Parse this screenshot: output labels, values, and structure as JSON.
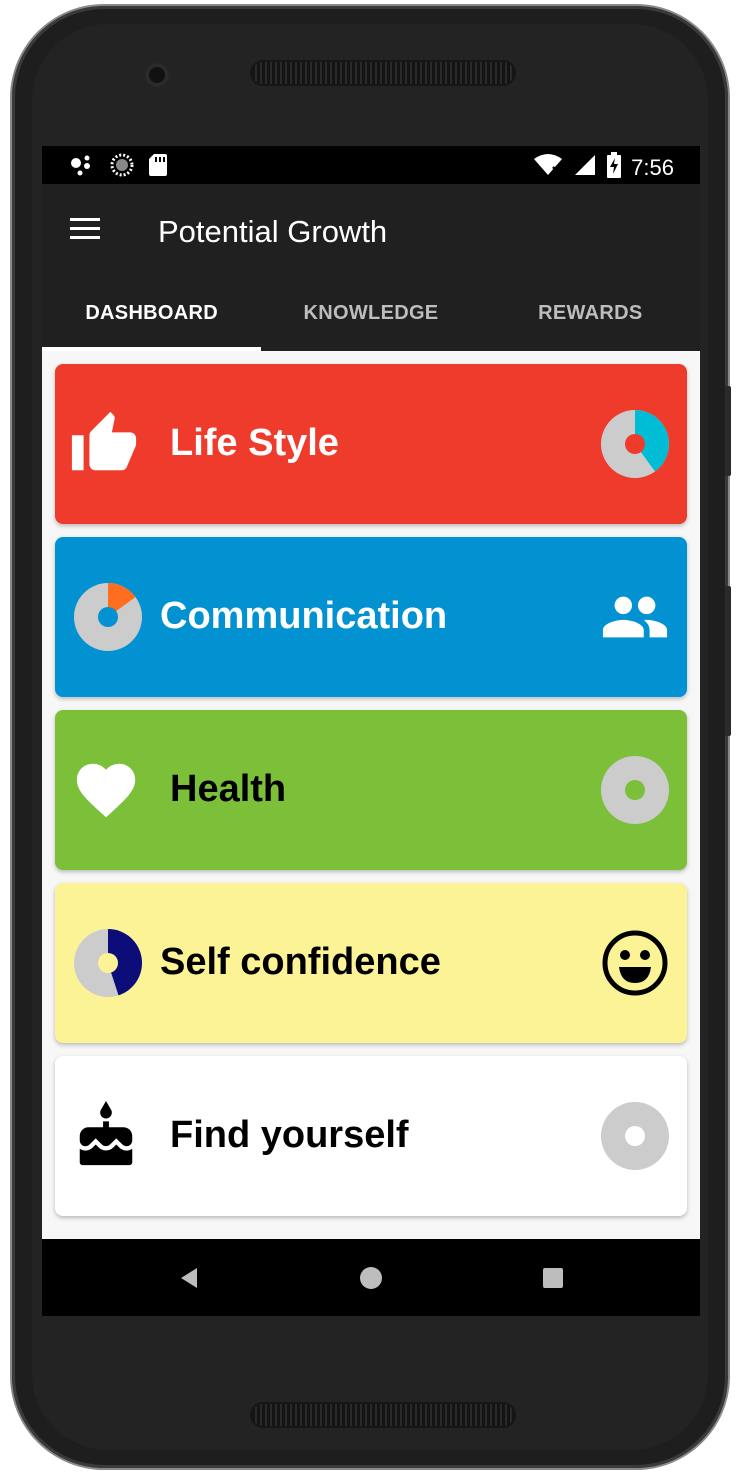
{
  "status_bar": {
    "time": "7:56",
    "left_icons": [
      "assistant-dots-icon",
      "loading-circle-icon",
      "sd-card-icon"
    ],
    "right_icons": [
      "wifi-icon",
      "signal-icon",
      "battery-charging-icon"
    ]
  },
  "app_bar": {
    "title": "Potential Growth",
    "menu_icon": "hamburger-menu-icon"
  },
  "tabs": [
    {
      "label": "DASHBOARD",
      "active": true
    },
    {
      "label": "KNOWLEDGE",
      "active": false
    },
    {
      "label": "REWARDS",
      "active": false
    }
  ],
  "cards": [
    {
      "label": "Life Style",
      "background": "#ef3b2c",
      "text_color": "#ffffff",
      "icon": "thumbs-up-icon",
      "progress_icon_side": "right",
      "progress": 0.4,
      "progress_color": "#00bcd4",
      "progress_center": "#ef3b2c"
    },
    {
      "label": "Communication",
      "background": "#0291d1",
      "text_color": "#ffffff",
      "icon": "people-icon",
      "progress_icon_side": "left",
      "progress": 0.15,
      "progress_color": "#ff6d1f",
      "progress_center": "#0291d1"
    },
    {
      "label": "Health",
      "background": "#7cc03a",
      "text_color": "#000000",
      "icon": "heart-icon",
      "progress_icon_side": "right",
      "progress": 0,
      "progress_color": "#7cc03a",
      "progress_center": "#7cc03a"
    },
    {
      "label": "Self confidence",
      "background": "#fbf396",
      "text_color": "#000000",
      "icon": "smiley-icon",
      "progress_icon_side": "left",
      "progress": 0.45,
      "progress_color": "#0d0d7a",
      "progress_center": "#fbf396"
    },
    {
      "label": "Find yourself",
      "background": "#ffffff",
      "text_color": "#000000",
      "icon": "cake-icon",
      "progress_icon_side": "right",
      "progress": 0,
      "progress_color": "#ffffff",
      "progress_center": "#ffffff"
    }
  ],
  "nav_bar": {
    "buttons": [
      "back-icon",
      "home-icon",
      "recents-icon"
    ]
  },
  "colors": {
    "app_bar": "#202020",
    "progress_track": "#cccccc"
  }
}
